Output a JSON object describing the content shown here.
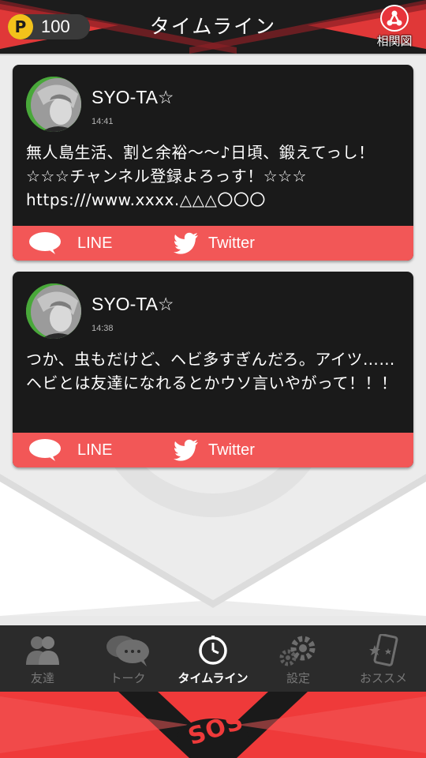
{
  "header": {
    "points_label": "P",
    "points_value": "100",
    "title": "タイムライン",
    "relation_label": "相関図"
  },
  "posts": [
    {
      "author": "SYO-TA☆",
      "time": "14:41",
      "text": "無人島生活、割と余裕～～♪日頃、鍛えてっし！ ☆☆☆チャンネル登録よろっす！☆☆☆\nhttps:///www.xxxx.△△△〇〇〇",
      "share_line_label": "LINE",
      "share_twitter_label": "Twitter"
    },
    {
      "author": "SYO-TA☆",
      "time": "14:38",
      "text": "つか、虫もだけど、ヘビ多すぎんだろ。アイツ……ヘビとは友達になれるとかウソ言いやがって！！！",
      "share_line_label": "LINE",
      "share_twitter_label": "Twitter"
    }
  ],
  "tabs": [
    {
      "label": "友達",
      "icon": "friends-icon",
      "active": false
    },
    {
      "label": "トーク",
      "icon": "chat-bubble-icon",
      "active": false
    },
    {
      "label": "タイムライン",
      "icon": "clock-icon",
      "active": true
    },
    {
      "label": "設定",
      "icon": "gear-icon",
      "active": false
    },
    {
      "label": "おススメ",
      "icon": "phone-star-icon",
      "active": false
    }
  ],
  "footer": {
    "sos_label": "SOS"
  },
  "colors": {
    "accent_red": "#f25757",
    "header_dark": "#1c1c1c",
    "coin_yellow": "#f2c21b",
    "tabbar": "#2b2b2b",
    "sos_red": "#ef3a3a"
  }
}
